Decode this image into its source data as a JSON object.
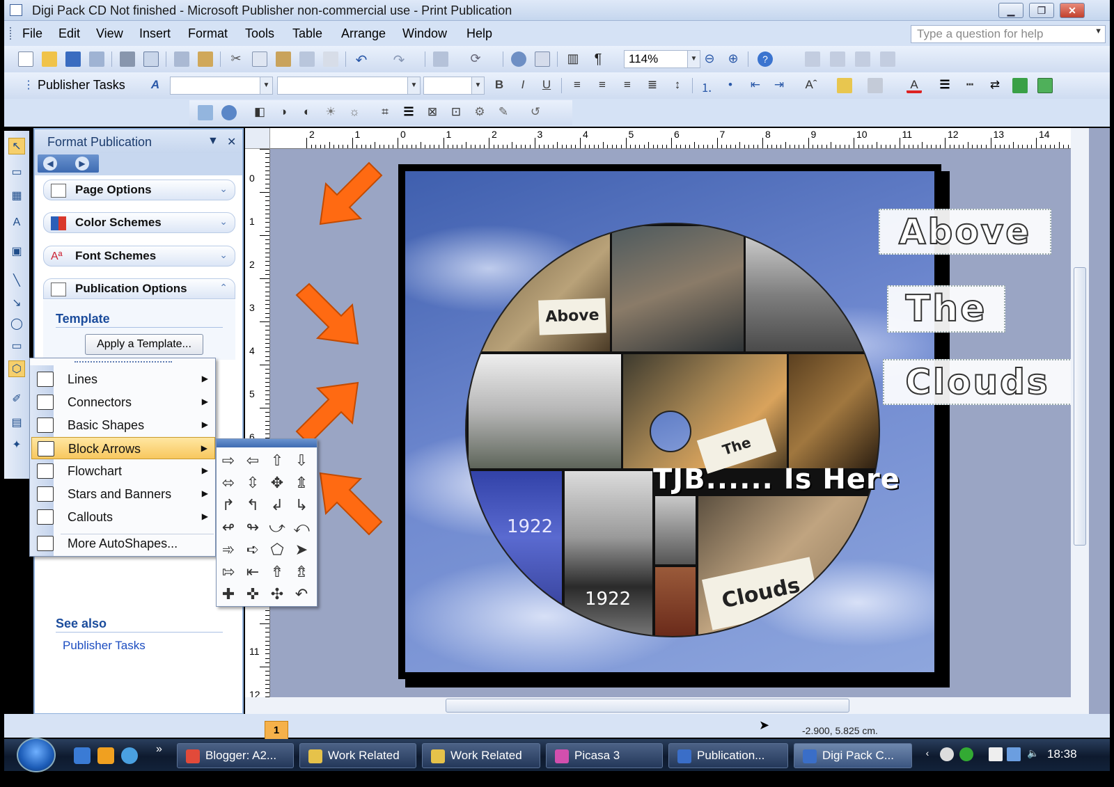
{
  "window": {
    "title": "Digi Pack CD Not finished - Microsoft Publisher non-commercial use - Print Publication"
  },
  "menu": [
    "File",
    "Edit",
    "View",
    "Insert",
    "Format",
    "Tools",
    "Table",
    "Arrange",
    "Window",
    "Help"
  ],
  "help_box": {
    "placeholder": "Type a question for help"
  },
  "toolbar": {
    "zoom": "114%",
    "publisher_tasks": "Publisher Tasks"
  },
  "task_pane": {
    "title": "Format Publication",
    "sections": [
      {
        "label": "Page Options",
        "icon": "page-icon",
        "expanded": false
      },
      {
        "label": "Color Schemes",
        "icon": "color-scheme-icon",
        "expanded": false
      },
      {
        "label": "Font Schemes",
        "icon": "font-scheme-icon",
        "expanded": false
      },
      {
        "label": "Publication Options",
        "icon": "publication-options-icon",
        "expanded": true
      }
    ],
    "template_heading": "Template",
    "apply_template_button": "Apply a Template...",
    "see_also_heading": "See also",
    "see_also_link": "Publisher Tasks"
  },
  "rulers": {
    "horizontal": [
      "2",
      "1",
      "0",
      "1",
      "2",
      "3",
      "4",
      "5",
      "6",
      "7",
      "8",
      "9",
      "10",
      "11",
      "12",
      "13",
      "14"
    ],
    "vertical": [
      "0",
      "1",
      "2",
      "3",
      "4",
      "5",
      "6",
      "11",
      "12"
    ]
  },
  "autoshapes_menu": {
    "items": [
      {
        "label": "Lines",
        "icon": "lines-icon",
        "submenu": true
      },
      {
        "label": "Connectors",
        "icon": "connectors-icon",
        "submenu": true
      },
      {
        "label": "Basic Shapes",
        "icon": "basic-shapes-icon",
        "submenu": true
      },
      {
        "label": "Block Arrows",
        "icon": "block-arrows-icon",
        "submenu": true,
        "active": true
      },
      {
        "label": "Flowchart",
        "icon": "flowchart-icon",
        "submenu": true
      },
      {
        "label": "Stars and Banners",
        "icon": "stars-banners-icon",
        "submenu": true
      },
      {
        "label": "Callouts",
        "icon": "callouts-icon",
        "submenu": true
      },
      {
        "label": "More AutoShapes...",
        "icon": "more-autoshapes-icon",
        "submenu": false
      }
    ]
  },
  "block_arrows": [
    [
      "⇨",
      "⇦",
      "⇧",
      "⇩"
    ],
    [
      "⬄",
      "⇳",
      "✥",
      "⇭"
    ],
    [
      "↱",
      "↰",
      "↲",
      "↳"
    ],
    [
      "↫",
      "↬",
      "⤻",
      "⤺"
    ],
    [
      "➾",
      "➪",
      "⬠",
      "➤"
    ],
    [
      "⇰",
      "⇤",
      "⇮",
      "⇯"
    ],
    [
      "✚",
      "✜",
      "✣",
      "↶"
    ]
  ],
  "publication": {
    "wordart": [
      "Above",
      "The",
      "Clouds"
    ],
    "disc_cards": [
      "Above",
      "The",
      "Clouds"
    ],
    "disc_caption": "TJB...... Is Here",
    "shirt_text": [
      "1922",
      "1922"
    ]
  },
  "status": {
    "page_number": "1",
    "coordinates": "-2.900, 5.825 cm."
  },
  "taskbar": {
    "tasks": [
      {
        "label": "Blogger: A2...",
        "icon": "chrome-icon",
        "active": false
      },
      {
        "label": "Work Related",
        "icon": "folder-icon",
        "active": false
      },
      {
        "label": "Work Related",
        "icon": "folder-icon",
        "active": false
      },
      {
        "label": "Picasa 3",
        "icon": "picasa-icon",
        "active": false
      },
      {
        "label": "Publication...",
        "icon": "publisher-icon",
        "active": false
      },
      {
        "label": "Digi Pack C...",
        "icon": "publisher-icon",
        "active": true
      }
    ],
    "time": "18:38"
  }
}
